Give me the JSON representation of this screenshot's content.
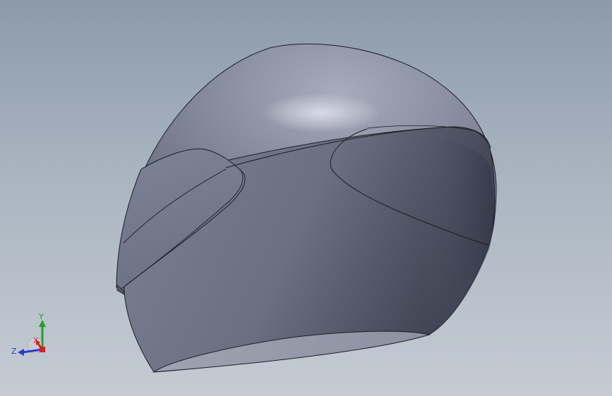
{
  "viewport": {
    "background_top": "#8c9aab",
    "background_bottom": "#c5cbd3"
  },
  "model": {
    "name": "helmet",
    "shell_color": "#6f7486",
    "edge_color": "#1c1c24"
  },
  "triad": {
    "x_label": "X",
    "y_label": "Y",
    "z_label": "Z",
    "x_color": "#d42020",
    "y_color": "#1fa02a",
    "z_color": "#2a3cc8"
  }
}
